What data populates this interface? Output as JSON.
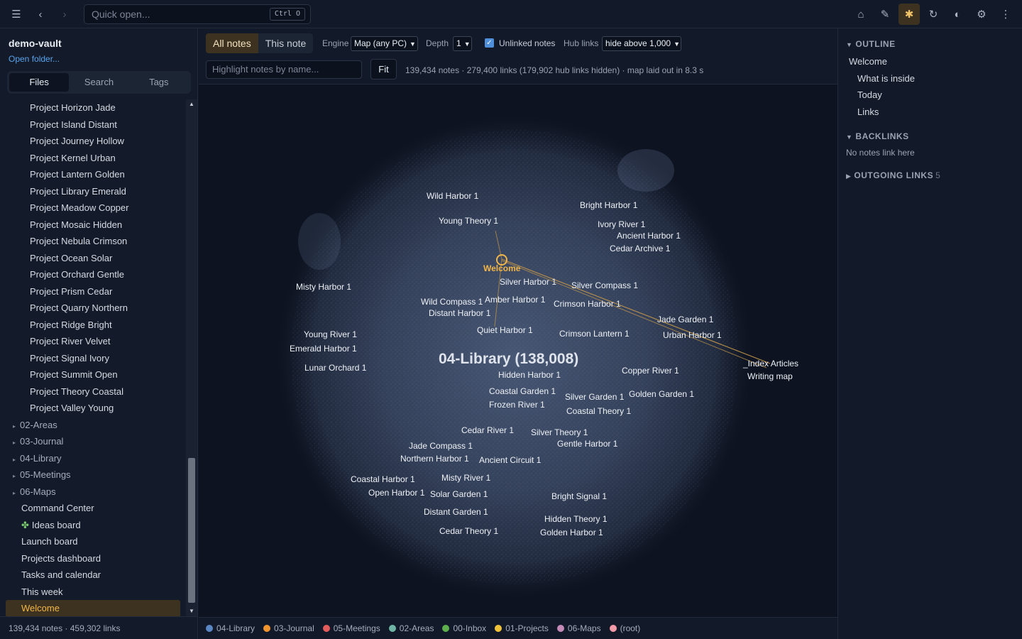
{
  "topbar": {
    "menu_icon": "hamburger-icon",
    "back_icon": "chevron-left-icon",
    "forward_icon": "chevron-right-icon",
    "quick_open_placeholder": "Quick open...",
    "quick_open_shortcut": "Ctrl O",
    "right_icons": [
      "home-icon",
      "pencil-icon",
      "graph-icon",
      "refresh-icon",
      "contrast-icon",
      "gear-icon",
      "more-icon"
    ]
  },
  "sidebar": {
    "vault_name": "demo-vault",
    "open_folder": "Open folder...",
    "tabs": [
      "Files",
      "Search",
      "Tags"
    ],
    "active_tab": "Files",
    "project_files": [
      "Project Horizon Jade",
      "Project Island Distant",
      "Project Journey Hollow",
      "Project Kernel Urban",
      "Project Lantern Golden",
      "Project Library Emerald",
      "Project Meadow Copper",
      "Project Mosaic Hidden",
      "Project Nebula Crimson",
      "Project Ocean Solar",
      "Project Orchard Gentle",
      "Project Prism Cedar",
      "Project Quarry Northern",
      "Project Ridge Bright",
      "Project River Velvet",
      "Project Signal Ivory",
      "Project Summit Open",
      "Project Theory Coastal",
      "Project Valley Young"
    ],
    "folders": [
      "02-Areas",
      "03-Journal",
      "04-Library",
      "05-Meetings",
      "06-Maps"
    ],
    "root_files": [
      "Command Center",
      "Ideas board",
      "Launch board",
      "Projects dashboard",
      "Tasks and calendar",
      "This week",
      "Welcome"
    ],
    "selected_file": "Welcome",
    "footer": "139,434 notes · 459,302 links"
  },
  "controls": {
    "scope_tabs": [
      "All notes",
      "This note"
    ],
    "active_scope": "All notes",
    "engine_label": "Engine",
    "engine_value": "Map (any PC)",
    "depth_label": "Depth",
    "depth_value": "1",
    "unlinked_label": "Unlinked notes",
    "unlinked_checked": true,
    "hub_label": "Hub links",
    "hub_value": "hide above 1,000",
    "highlight_placeholder": "Highlight notes by name...",
    "fit_label": "Fit",
    "stats": "139,434 notes · 279,400 links (179,902 hub links hidden) · map laid out in 8.3 s"
  },
  "graph": {
    "cluster_label": "04-Library (138,008)",
    "focus_node": "Welcome",
    "outside_nodes": [
      "_Index Articles",
      "Writing map"
    ],
    "nodes": [
      "Wild Harbor 1",
      "Bright Harbor 1",
      "Young Theory 1",
      "Ivory River 1",
      "Ancient Harbor 1",
      "Cedar Archive 1",
      "Misty Harbor 1",
      "Silver Harbor 1",
      "Silver Compass 1",
      "Wild Compass 1",
      "Amber Harbor 1",
      "Crimson Harbor 1",
      "Distant Harbor 1",
      "Jade Garden 1",
      "Young River 1",
      "Quiet Harbor 1",
      "Crimson Lantern 1",
      "Urban Harbor 1",
      "Emerald Harbor 1",
      "Lunar Orchard 1",
      "Hidden Harbor 1",
      "Copper River 1",
      "Coastal Garden 1",
      "Silver Garden 1",
      "Golden Garden 1",
      "Frozen River 1",
      "Coastal Theory 1",
      "Cedar River 1",
      "Silver Theory 1",
      "Jade Compass 1",
      "Gentle Harbor 1",
      "Northern Harbor 1",
      "Ancient Circuit 1",
      "Coastal Harbor 1",
      "Misty River 1",
      "Open Harbor 1",
      "Solar Garden 1",
      "Bright Signal 1",
      "Distant Garden 1",
      "Hidden Theory 1",
      "Cedar Theory 1",
      "Golden Harbor 1"
    ],
    "colors": {
      "cluster": "#5b7aa8",
      "focus": "#f3b648",
      "edge": "#c99a48"
    }
  },
  "legend": [
    {
      "label": "04-Library",
      "color": "#5b86c4"
    },
    {
      "label": "03-Journal",
      "color": "#f0952e"
    },
    {
      "label": "05-Meetings",
      "color": "#e35b5b"
    },
    {
      "label": "02-Areas",
      "color": "#6fb5a6"
    },
    {
      "label": "00-Inbox",
      "color": "#5fae4e"
    },
    {
      "label": "01-Projects",
      "color": "#f0c23a"
    },
    {
      "label": "06-Maps",
      "color": "#c58ab8"
    },
    {
      "label": "(root)",
      "color": "#f29aa8"
    }
  ],
  "right_panel": {
    "outline_heading": "OUTLINE",
    "outline_items": [
      "Welcome",
      "What is inside",
      "Today",
      "Links"
    ],
    "backlinks_heading": "BACKLINKS",
    "backlinks_empty": "No notes link here",
    "outgoing_heading": "OUTGOING LINKS",
    "outgoing_count": "5"
  }
}
